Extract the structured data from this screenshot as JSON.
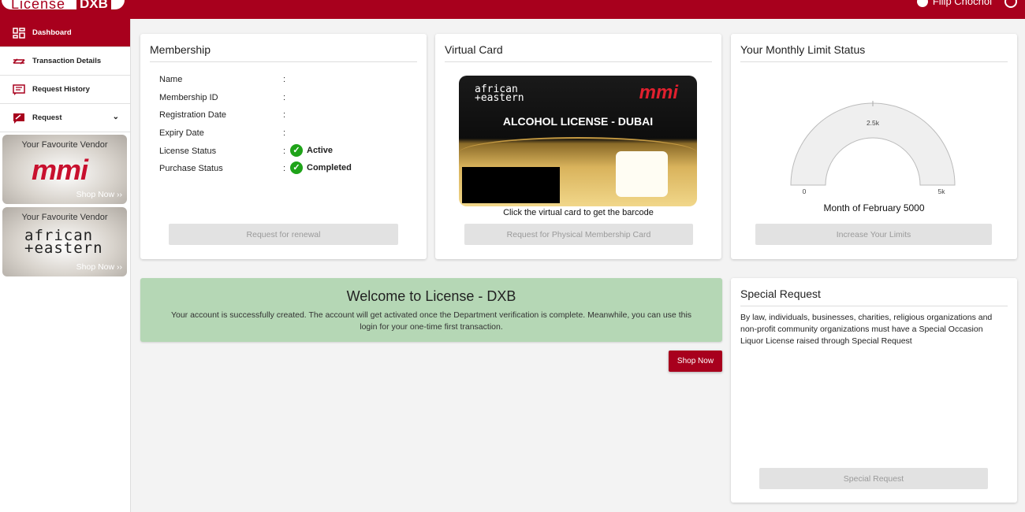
{
  "app": {
    "logo_text": "License",
    "logo_badge": "DXB"
  },
  "header": {
    "user_name": "Filip Chochol"
  },
  "sidebar": {
    "items": [
      {
        "label": "Dashboard"
      },
      {
        "label": "Transaction Details"
      },
      {
        "label": "Request History"
      },
      {
        "label": "Request"
      }
    ],
    "vendors": [
      {
        "title": "Your Favourite Vendor",
        "logo": "mmi",
        "cta": "Shop Now ››"
      },
      {
        "title": "Your Favourite Vendor",
        "logo_line1": "african",
        "logo_line2": "+eastern",
        "cta": "Shop Now ››"
      }
    ]
  },
  "membership": {
    "title": "Membership",
    "rows": [
      {
        "label": "Name",
        "value": ""
      },
      {
        "label": "Membership ID",
        "value": ""
      },
      {
        "label": "Registration Date",
        "value": ""
      },
      {
        "label": "Expiry Date",
        "value": ""
      },
      {
        "label": "License Status",
        "value": "Active"
      },
      {
        "label": "Purchase Status",
        "value": "Completed"
      }
    ],
    "button": "Request for renewal"
  },
  "virtual_card": {
    "title": "Virtual Card",
    "card_brand_line1": "african",
    "card_brand_line2": "+eastern",
    "card_logo": "mmi",
    "card_heading": "ALCOHOL LICENSE - DUBAI",
    "caption": "Click the virtual card to get the barcode",
    "button": "Request for Physical Membership Card"
  },
  "limit": {
    "title": "Your Monthly Limit Status",
    "gauge_min": "0",
    "gauge_mid": "2.5k",
    "gauge_max": "5k",
    "gauge_value": 0,
    "caption": "Month of February 5000",
    "button": "Increase Your Limits"
  },
  "welcome": {
    "title": "Welcome to License - DXB",
    "text": "Your account is successfully created. The account will get activated once the Department verification is complete. Meanwhile, you can use this login for your one-time first transaction.",
    "shop_button": "Shop Now"
  },
  "special_request": {
    "title": "Special Request",
    "text": "By law, individuals, businesses, charities, religious organizations and non-profit community organizations must have a Special Occasion Liquor License raised through Special Request",
    "button": "Special Request"
  },
  "colors": {
    "brand": "#a8001d",
    "success": "#1fa319",
    "welcome_bg": "#b5d7b5"
  }
}
